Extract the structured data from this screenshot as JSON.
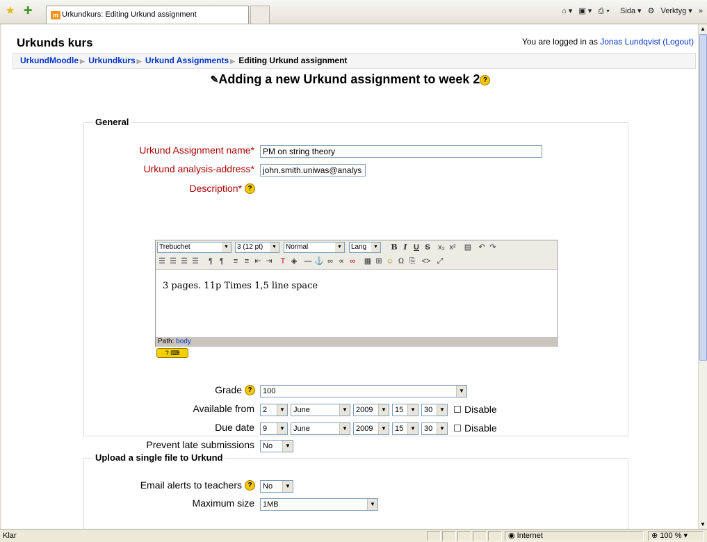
{
  "browser": {
    "tab_title": "Urkundkurs: Editing Urkund assignment",
    "page_label": "Sida",
    "tools_label": "Verktyg",
    "status_text": "Klar",
    "zone": "Internet",
    "zoom": "100 %"
  },
  "header": {
    "site_title": "Urkunds kurs",
    "login_prefix": "You are logged in as ",
    "user_name": "Jonas Lundqvist",
    "logout_label": "(Logout)"
  },
  "breadcrumb": {
    "items": [
      "UrkundMoodle",
      "Urkundkurs",
      "Urkund Assignments"
    ],
    "current": "Editing Urkund assignment"
  },
  "page": {
    "heading": "Adding a new Urkund assignment to week 2"
  },
  "general": {
    "legend": "General",
    "name_label": "Urkund Assignment name*",
    "name_value": "PM on string theory",
    "address_label": "Urkund analysis-address*",
    "address_value": "john.smith.uniwas@analys",
    "description_label": "Description*",
    "editor": {
      "font": "Trebuchet",
      "size": "3 (12 pt)",
      "format": "Normal",
      "lang": "Lang",
      "content": "3 pages. 11p Times 1,5 line space",
      "path_label": "Path:",
      "path_value": "body"
    },
    "grade_label": "Grade",
    "grade_value": "100",
    "available_label": "Available from",
    "available": {
      "day": "2",
      "month": "June",
      "year": "2009",
      "hour": "15",
      "minute": "30"
    },
    "due_label": "Due date",
    "due": {
      "day": "9",
      "month": "June",
      "year": "2009",
      "hour": "15",
      "minute": "30"
    },
    "disable_label": "Disable",
    "prevent_label": "Prevent late submissions",
    "prevent_value": "No"
  },
  "upload": {
    "legend": "Upload a single file to Urkund",
    "email_label": "Email alerts to teachers",
    "email_value": "No",
    "max_size_label": "Maximum size",
    "max_size_value": "1MB"
  }
}
